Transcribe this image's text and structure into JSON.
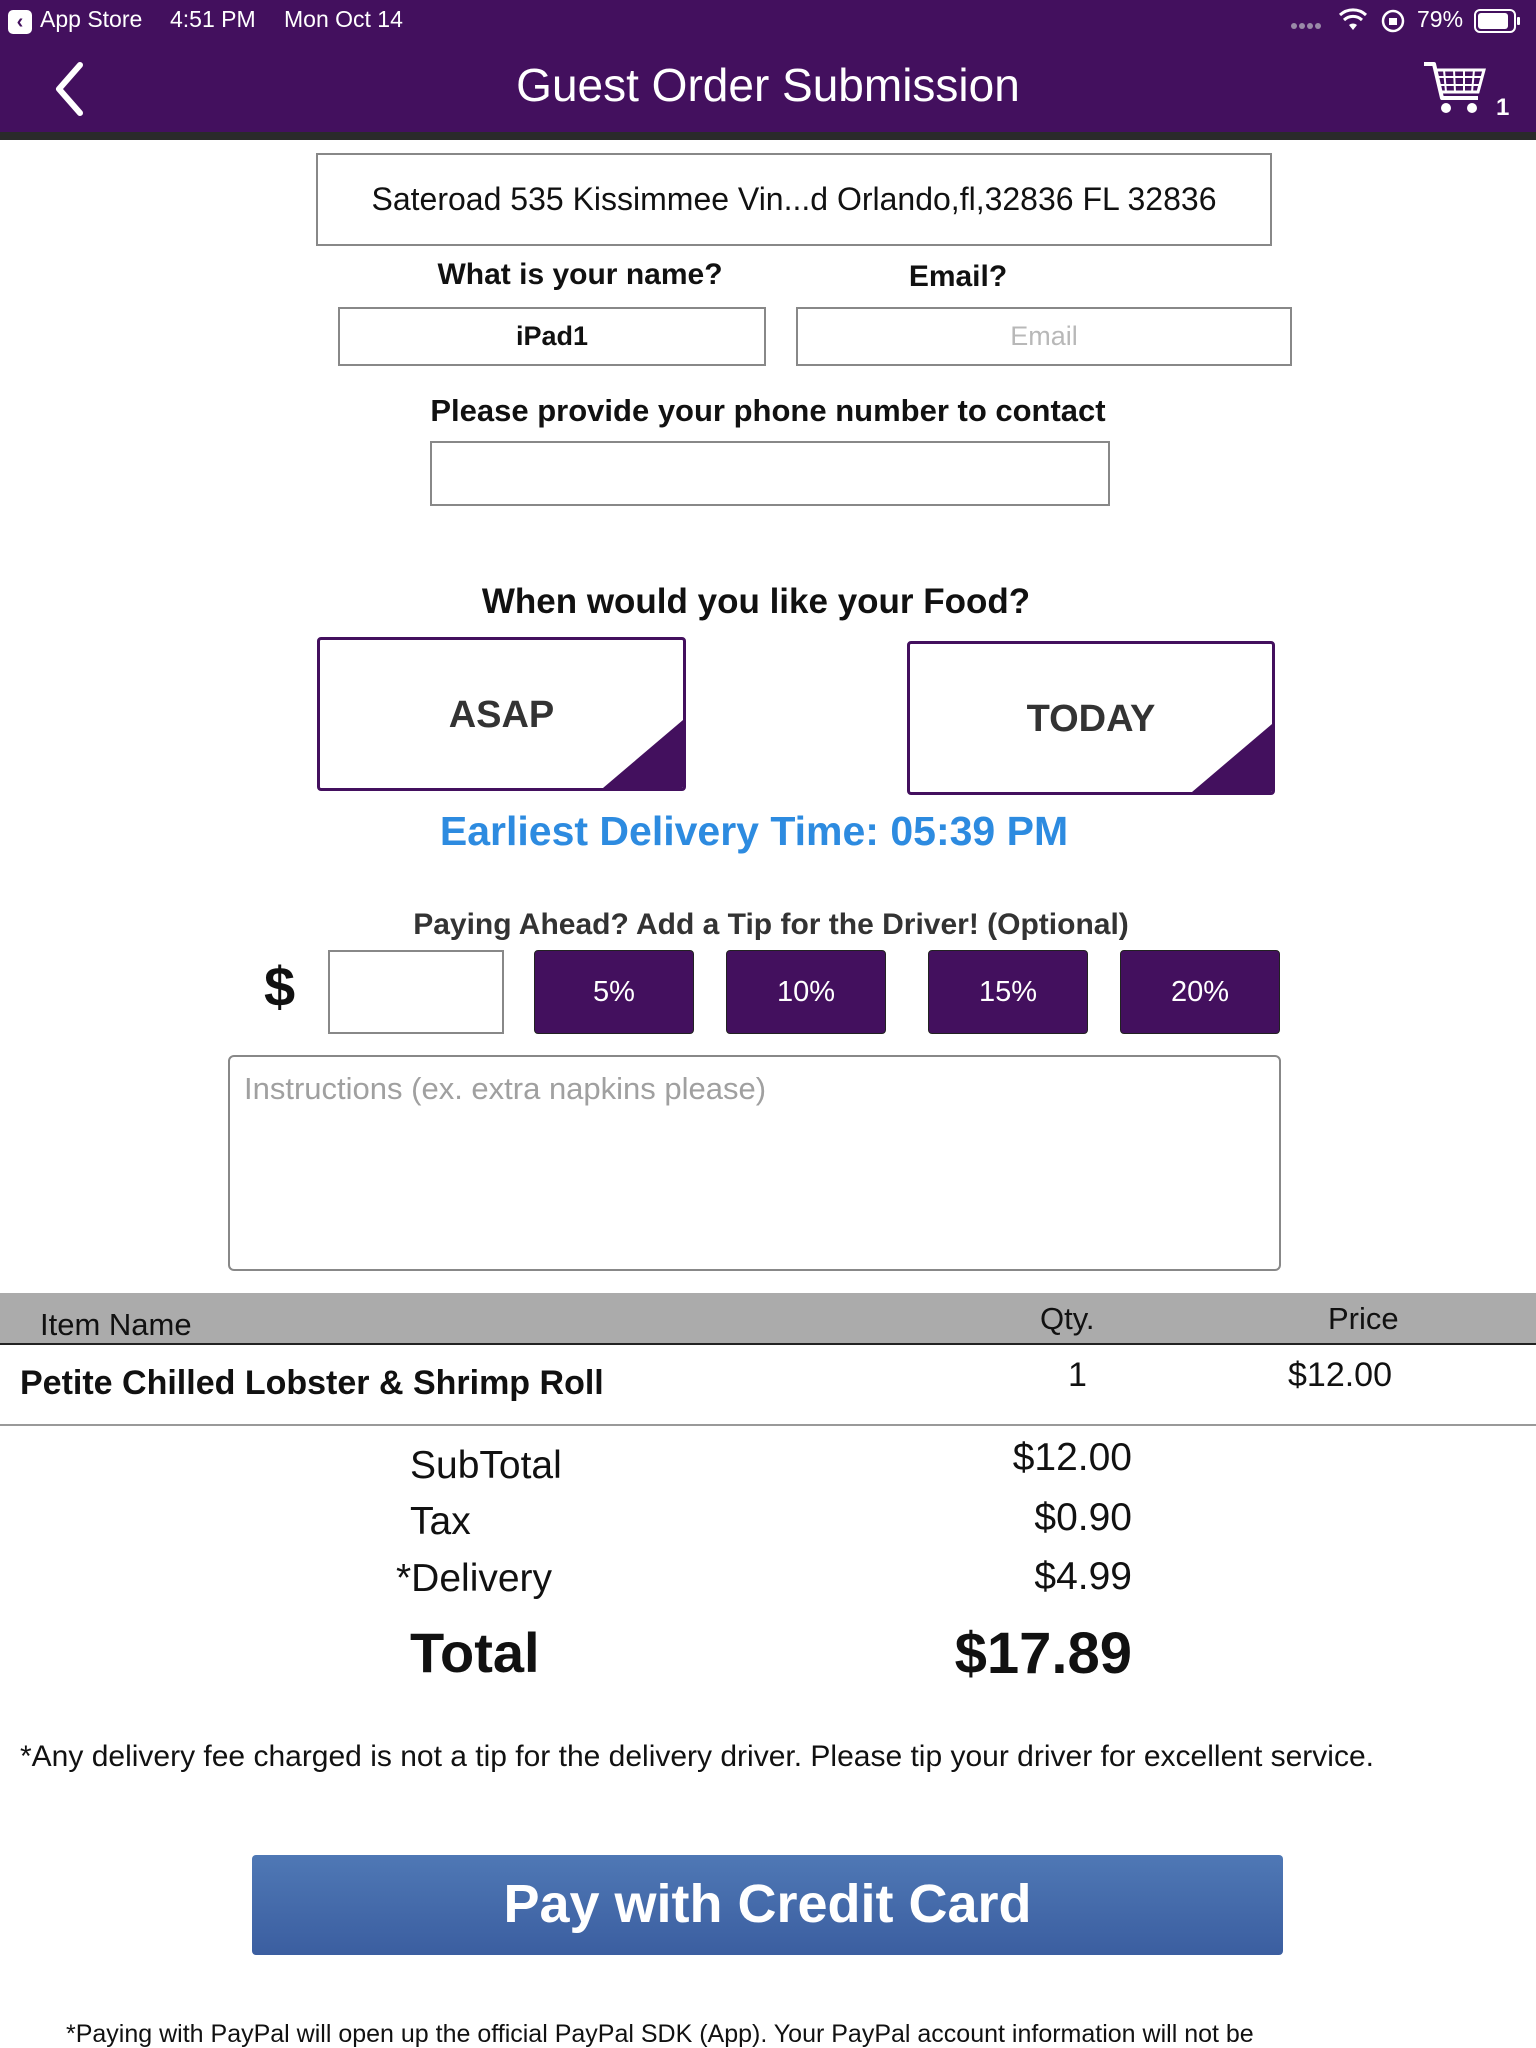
{
  "status_bar": {
    "back_app": "App Store",
    "time": "4:51 PM",
    "date": "Mon Oct 14",
    "battery": "79%"
  },
  "nav": {
    "title": "Guest Order Submission",
    "cart_count": "1"
  },
  "address": "Sateroad 535 Kissimmee Vin...d Orlando,fl,32836 FL 32836",
  "form": {
    "name_label": "What is your name?",
    "name_value": "iPad1",
    "email_label": "Email?",
    "email_placeholder": "Email",
    "phone_label": "Please provide your phone number to contact"
  },
  "timing": {
    "label": "When would you like your Food?",
    "asap": "ASAP",
    "today": "TODAY",
    "earliest": "Earliest Delivery Time: 05:39 PM"
  },
  "tip": {
    "label": "Paying Ahead? Add a Tip for the Driver! (Optional)",
    "currency": "$",
    "options": [
      "5%",
      "10%",
      "15%",
      "20%"
    ]
  },
  "instructions_placeholder": "Instructions (ex. extra napkins please)",
  "table": {
    "headers": [
      "Item Name",
      "Qty.",
      "Price"
    ],
    "rows": [
      {
        "name": "Petite Chilled Lobster & Shrimp Roll",
        "qty": "1",
        "price": "$12.00"
      }
    ]
  },
  "totals": {
    "subtotal_label": "SubTotal",
    "subtotal": "$12.00",
    "tax_label": "Tax",
    "tax": "$0.90",
    "delivery_label": "*Delivery",
    "delivery": "$4.99",
    "total_label": "Total",
    "total": "$17.89"
  },
  "disclaimer": "*Any delivery fee charged is not a tip for the delivery driver. Please tip your driver for excellent service.",
  "pay_button": "Pay with Credit Card",
  "paypal_note": "*Paying with PayPal will open up the official PayPal SDK (App). Your PayPal account information will not be",
  "colors": {
    "brand_purple": "#43105e",
    "delivery_blue": "#2d8be0",
    "pay_blue": "#4468a8",
    "table_header": "#ababab"
  }
}
